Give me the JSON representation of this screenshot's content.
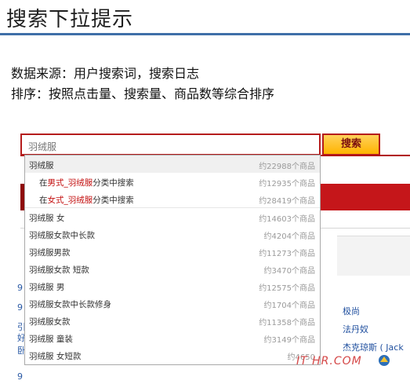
{
  "slide": {
    "title": "搜索下拉提示",
    "line1": "数据来源：用户搜索词，搜索日志",
    "line2": "排序：按照点击量、搜索量、商品数等综合排序"
  },
  "search": {
    "value": "羽绒服",
    "button_label": "搜索"
  },
  "suggestions": [
    {
      "q": "羽绒服",
      "count": "约22988个商品"
    },
    {
      "prefix": "在",
      "cat": "男式_羽绒服",
      "suffix": "分类中搜索",
      "count": "约12935个商品"
    },
    {
      "prefix": "在",
      "cat": "女式_羽绒服",
      "suffix": "分类中搜索",
      "count": "约28419个商品"
    },
    {
      "q": "羽绒服 女",
      "count": "约14603个商品"
    },
    {
      "q": "羽绒服女款中长款",
      "count": "约4204个商品"
    },
    {
      "q": "羽绒服男款",
      "count": "约11273个商品"
    },
    {
      "q": "羽绒服女款 短款",
      "count": "约3470个商品"
    },
    {
      "q": "羽绒服 男",
      "count": "约12575个商品"
    },
    {
      "q": "羽绒服女款中长款修身",
      "count": "约1704个商品"
    },
    {
      "q": "羽绒服女款",
      "count": "约11358个商品"
    },
    {
      "q": "羽绒服 童装",
      "count": "约3149个商品"
    },
    {
      "q": "羽绒服 女短款",
      "count": "约4650"
    }
  ],
  "background": {
    "links": [
      "极尚",
      "法丹奴",
      "杰克琼斯 ( Jack"
    ],
    "left_chars": [
      "9",
      "9",
      "引",
      "好",
      "卧",
      "9"
    ]
  },
  "watermark": "IT HR.COM"
}
